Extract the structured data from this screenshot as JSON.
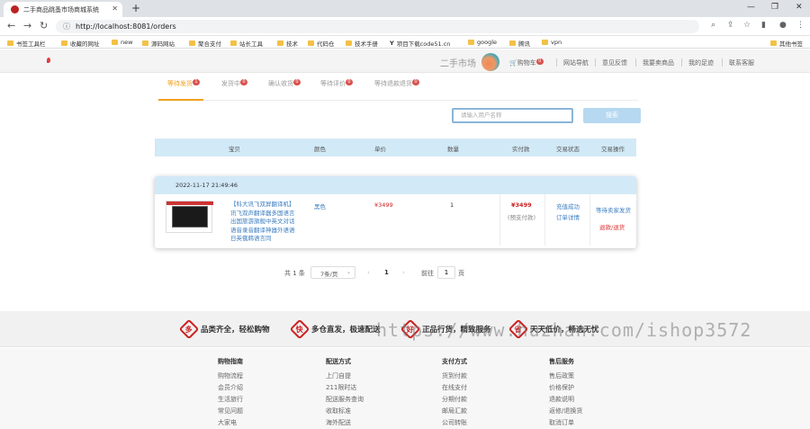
{
  "browser": {
    "tab_title": "二手商品跳蚤市场商城系统",
    "url": "http://localhost:8081/orders",
    "bookmarks": [
      "书签工具栏",
      "收藏的网址",
      "new",
      "源码网站",
      "聚合支付",
      "站长工具",
      "技术",
      "代码仓",
      "技术手册",
      "项目下载code51.cn",
      "google",
      "腾讯",
      "vpn"
    ],
    "other_bookmarks": "其他书签"
  },
  "site": {
    "logo_text": "二手市场",
    "nav": {
      "cart": "购物车",
      "cart_count": "0",
      "nav": "网站导航",
      "feedback": "意见反馈",
      "sell": "我要卖商品",
      "tracks": "我的足迹",
      "service": "联系客服"
    }
  },
  "order_tabs": [
    {
      "label": "等待发货",
      "count": "1"
    },
    {
      "label": "发货中",
      "count": "0"
    },
    {
      "label": "确认收货",
      "count": "0"
    },
    {
      "label": "等待评价",
      "count": "0"
    },
    {
      "label": "等待退款退货",
      "count": "0"
    }
  ],
  "search": {
    "placeholder": "请输入用户名称",
    "button": "搜索"
  },
  "table_headers": [
    "宝贝",
    "颜色",
    "单价",
    "数量",
    "实付款",
    "交易状态",
    "交易操作"
  ],
  "order": {
    "date": "2022-11-17 21:49:46",
    "product_name": "【科大讯飞双屏翻译机】讯飞双声翻译器多国语言出国旅游旗舰中英文对话语音录音翻译神器外语语日英俄韩语言同",
    "color": "黑色",
    "price": "¥3499",
    "quantity": "1",
    "paid": "¥3499",
    "paid_note": "(预支付款)",
    "status": "充值成功",
    "detail": "订单详情",
    "action_wait": "等待卖家发货",
    "action_refund": "退款/退货"
  },
  "pagination": {
    "total": "共 1 条",
    "page_size": "7条/页",
    "prev": "‹",
    "page": "1",
    "next": "›",
    "goto_label": "前往",
    "goto_value": "1",
    "page_unit": "页"
  },
  "features": [
    {
      "icon": "多",
      "text": "品类齐全，轻松购物"
    },
    {
      "icon": "快",
      "text": "多仓直发，极速配送"
    },
    {
      "icon": "好",
      "text": "正品行货，精致服务"
    },
    {
      "icon": "省",
      "text": "天天低价，畅选无忧"
    }
  ],
  "watermark": "https://www.huzhan.com/ishop3572",
  "footer_columns": [
    {
      "title": "购物指南",
      "items": [
        "购物流程",
        "会员介绍",
        "生活旅行",
        "常见问题",
        "大家电"
      ]
    },
    {
      "title": "配送方式",
      "items": [
        "上门自提",
        "211限时达",
        "配送服务查询",
        "收取标准",
        "海外配送"
      ]
    },
    {
      "title": "支付方式",
      "items": [
        "货到付款",
        "在线支付",
        "分期付款",
        "邮局汇款",
        "公司转账"
      ]
    },
    {
      "title": "售后服务",
      "items": [
        "售后政策",
        "价格保护",
        "退款说明",
        "返修/退换货",
        "取消订单"
      ]
    }
  ],
  "colors": {
    "accent": "#f0a020",
    "header_blue": "#d2e9f7",
    "price_red": "#c22"
  }
}
